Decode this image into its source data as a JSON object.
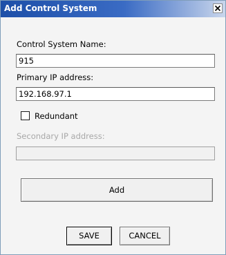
{
  "window": {
    "title": "Add Control System",
    "close_symbol": "×",
    "close_icon": "close-icon"
  },
  "form": {
    "name_label": "Control System Name:",
    "name_value": "915",
    "primary_ip_label": "Primary IP address:",
    "primary_ip_value": "192.168.97.1",
    "redundant_label": "Redundant",
    "redundant_checked": false,
    "secondary_ip_label": "Secondary IP address:",
    "secondary_ip_value": "",
    "secondary_ip_enabled": false
  },
  "buttons": {
    "add_label": "Add",
    "save_label": "SAVE",
    "cancel_label": "CANCEL"
  },
  "colors": {
    "titlebar_start": "#1d4fa8",
    "titlebar_end": "#c9d6ec",
    "dialog_background": "#f4f4f4",
    "disabled_text": "#a8a8a8"
  }
}
